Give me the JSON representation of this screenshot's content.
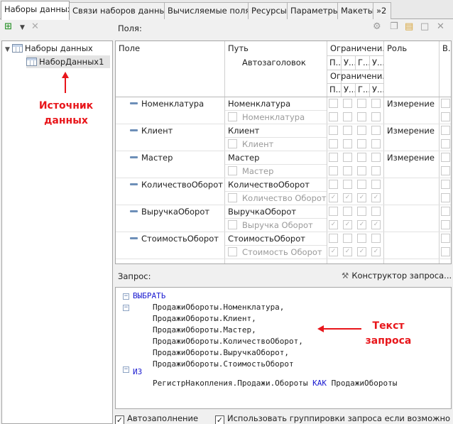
{
  "tabs": [
    "Наборы данных",
    "Связи наборов данных",
    "Вычисляемые поля",
    "Ресурсы",
    "Параметры",
    "Макеты",
    "»2"
  ],
  "left_panel": {
    "tree": {
      "root": "Наборы данных",
      "child": "НаборДанных1"
    },
    "annotation": [
      "Источник",
      "данных"
    ]
  },
  "fields_panel": {
    "label": "Поля:",
    "columns": {
      "field": "Поле",
      "path": "Путь",
      "restrict": "Ограничени...",
      "role": "Роль",
      "extra": "В..."
    },
    "autoheader": "Автозаголовок",
    "subheader_row1": [
      "П...",
      "У...",
      "Г...",
      "У..."
    ],
    "restrict2": "Ограничени...",
    "subheader_row3": [
      "П...",
      "У...",
      "Г...",
      "У..."
    ],
    "rows": [
      {
        "field": "Номенклатура",
        "path": "Номенклатура",
        "title": "Номенклатура",
        "role": "Измерение",
        "checked": false
      },
      {
        "field": "Клиент",
        "path": "Клиент",
        "title": "Клиент",
        "role": "Измерение",
        "checked": false
      },
      {
        "field": "Мастер",
        "path": "Мастер",
        "title": "Мастер",
        "role": "Измерение",
        "checked": false
      },
      {
        "field": "КоличествоОборот",
        "path": "КоличествоОборот",
        "title": "Количество Оборот",
        "role": "",
        "checked": true
      },
      {
        "field": "ВыручкаОборот",
        "path": "ВыручкаОборот",
        "title": "Выручка Оборот",
        "role": "",
        "checked": true
      },
      {
        "field": "СтоимостьОборот",
        "path": "СтоимостьОборот",
        "title": "Стоимость Оборот",
        "role": "",
        "checked": true
      }
    ]
  },
  "query_panel": {
    "label": "Запрос:",
    "constructor_button": "Конструктор запроса...",
    "select_kw": "ВЫБРАТЬ",
    "select_lines": [
      "ПродажиОбороты.Номенклатура,",
      "ПродажиОбороты.Клиент,",
      "ПродажиОбороты.Мастер,",
      "ПродажиОбороты.КоличествоОборот,",
      "ПродажиОбороты.ВыручкаОборот,",
      "ПродажиОбороты.СтоимостьОборот"
    ],
    "from_kw": "ИЗ",
    "from_source": "РегистрНакопления.Продажи.Обороты",
    "as_kw": "КАК",
    "from_alias": "ПродажиОбороты",
    "annotation": [
      "Текст",
      "запроса"
    ]
  },
  "bottom": {
    "autofill": "Автозаполнение",
    "use_grouping": "Использовать группировки запроса если возможно"
  },
  "colors": {
    "annotation": "#e8161b",
    "keyword": "#1b1bd0"
  }
}
